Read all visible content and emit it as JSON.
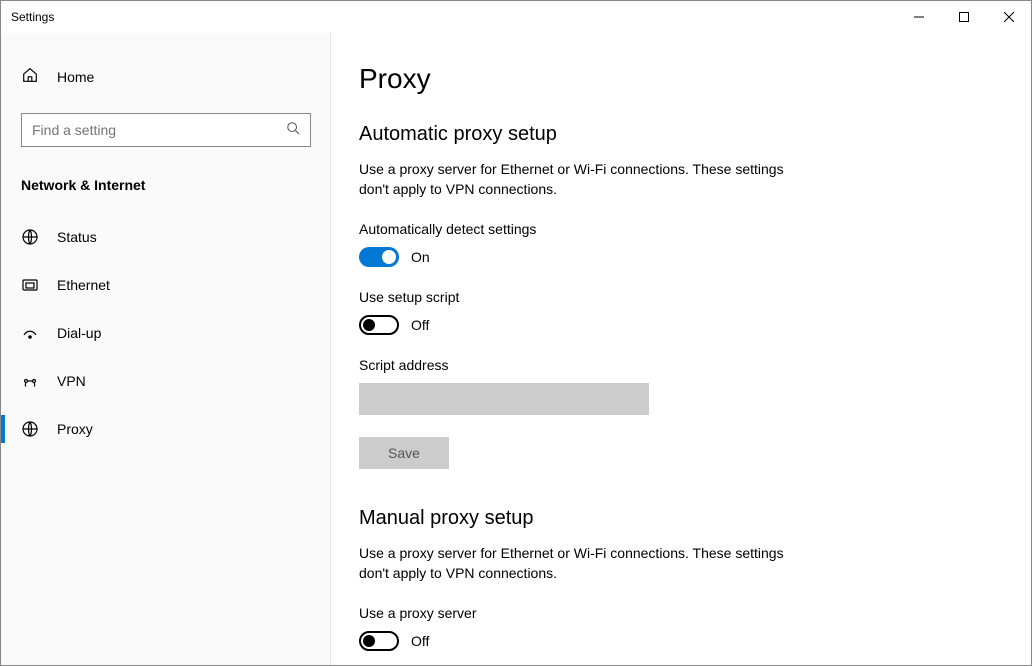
{
  "window": {
    "title": "Settings"
  },
  "sidebar": {
    "home": "Home",
    "search_placeholder": "Find a setting",
    "section": "Network & Internet",
    "items": [
      {
        "label": "Status"
      },
      {
        "label": "Ethernet"
      },
      {
        "label": "Dial-up"
      },
      {
        "label": "VPN"
      },
      {
        "label": "Proxy"
      }
    ]
  },
  "page": {
    "title": "Proxy",
    "auto": {
      "heading": "Automatic proxy setup",
      "desc": "Use a proxy server for Ethernet or Wi-Fi connections. These settings don't apply to VPN connections.",
      "detect_label": "Automatically detect settings",
      "detect_state": "On",
      "script_label": "Use setup script",
      "script_state": "Off",
      "address_label": "Script address",
      "address_value": "",
      "save": "Save"
    },
    "manual": {
      "heading": "Manual proxy setup",
      "desc": "Use a proxy server for Ethernet or Wi-Fi connections. These settings don't apply to VPN connections.",
      "use_label": "Use a proxy server",
      "use_state": "Off"
    }
  }
}
